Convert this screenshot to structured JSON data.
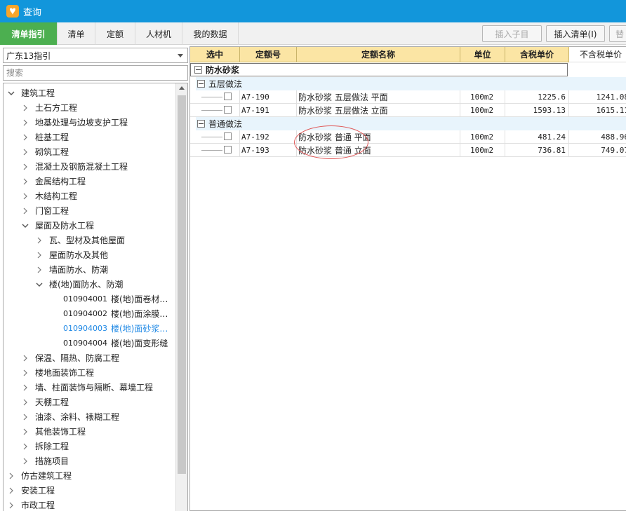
{
  "window": {
    "title": "查询"
  },
  "tabs": [
    {
      "label": "清单指引",
      "active": true
    },
    {
      "label": "清单",
      "active": false
    },
    {
      "label": "定额",
      "active": false
    },
    {
      "label": "人材机",
      "active": false
    },
    {
      "label": "我的数据",
      "active": false
    }
  ],
  "toolbar": {
    "insert_child_label": "插入子目",
    "insert_list_label": "插入清单(I)",
    "replace_label": "替"
  },
  "left": {
    "region_select": "广东13指引",
    "search_placeholder": "搜索",
    "tree": [
      {
        "label": "建筑工程",
        "state": "expanded"
      },
      {
        "label": "土石方工程",
        "state": "collapsed"
      },
      {
        "label": "地基处理与边坡支护工程",
        "state": "collapsed"
      },
      {
        "label": "桩基工程",
        "state": "collapsed"
      },
      {
        "label": "砌筑工程",
        "state": "collapsed"
      },
      {
        "label": "混凝土及钢筋混凝土工程",
        "state": "collapsed"
      },
      {
        "label": "金属结构工程",
        "state": "collapsed"
      },
      {
        "label": "木结构工程",
        "state": "collapsed"
      },
      {
        "label": "门窗工程",
        "state": "collapsed"
      },
      {
        "label": "屋面及防水工程",
        "state": "expanded"
      },
      {
        "label": "瓦、型材及其他屋面",
        "state": "collapsed"
      },
      {
        "label": "屋面防水及其他",
        "state": "collapsed"
      },
      {
        "label": "墙面防水、防潮",
        "state": "collapsed"
      },
      {
        "label": "楼(地)面防水、防潮",
        "state": "expanded"
      },
      {
        "code": "010904001",
        "label": "楼(地)面卷材…",
        "state": "leaf"
      },
      {
        "code": "010904002",
        "label": "楼(地)面涂膜…",
        "state": "leaf"
      },
      {
        "code": "010904003",
        "label": "楼(地)面砂浆…",
        "state": "leaf",
        "selected": true
      },
      {
        "code": "010904004",
        "label": "楼(地)面变形缝",
        "state": "leaf"
      },
      {
        "label": "保温、隔热、防腐工程",
        "state": "collapsed"
      },
      {
        "label": "楼地面装饰工程",
        "state": "collapsed"
      },
      {
        "label": "墙、柱面装饰与隔断、幕墙工程",
        "state": "collapsed"
      },
      {
        "label": "天棚工程",
        "state": "collapsed"
      },
      {
        "label": "油漆、涂料、裱糊工程",
        "state": "collapsed"
      },
      {
        "label": "其他装饰工程",
        "state": "collapsed"
      },
      {
        "label": "拆除工程",
        "state": "collapsed"
      },
      {
        "label": "措施项目",
        "state": "collapsed"
      },
      {
        "label": "仿古建筑工程",
        "state": "collapsed"
      },
      {
        "label": "安装工程",
        "state": "collapsed"
      },
      {
        "label": "市政工程",
        "state": "collapsed"
      }
    ]
  },
  "grid": {
    "headers": [
      "选中",
      "定额号",
      "定额名称",
      "单位",
      "含税单价",
      "不含税单价"
    ],
    "group_title": "防水砂浆",
    "subgroups": [
      {
        "title": "五层做法",
        "rows": [
          {
            "code": "A7-190",
            "name": "防水砂浆 五层做法 平面",
            "unit": "100m2",
            "price_tax": "1225.6",
            "price_notax": "1241.08"
          },
          {
            "code": "A7-191",
            "name": "防水砂浆 五层做法 立面",
            "unit": "100m2",
            "price_tax": "1593.13",
            "price_notax": "1615.11"
          }
        ]
      },
      {
        "title": "普通做法",
        "rows": [
          {
            "code": "A7-192",
            "name": "防水砂浆 普通 平面",
            "unit": "100m2",
            "price_tax": "481.24",
            "price_notax": "488.96"
          },
          {
            "code": "A7-193",
            "name": "防水砂浆 普通 立面",
            "unit": "100m2",
            "price_tax": "736.81",
            "price_notax": "749.07"
          }
        ]
      }
    ]
  },
  "colors": {
    "titlebar": "#1296db",
    "active_tab": "#4caf50",
    "header": "#fbe5a4",
    "subgroup": "#e8f4fc",
    "selected_text": "#1e88e5",
    "annotation": "#e05555"
  }
}
